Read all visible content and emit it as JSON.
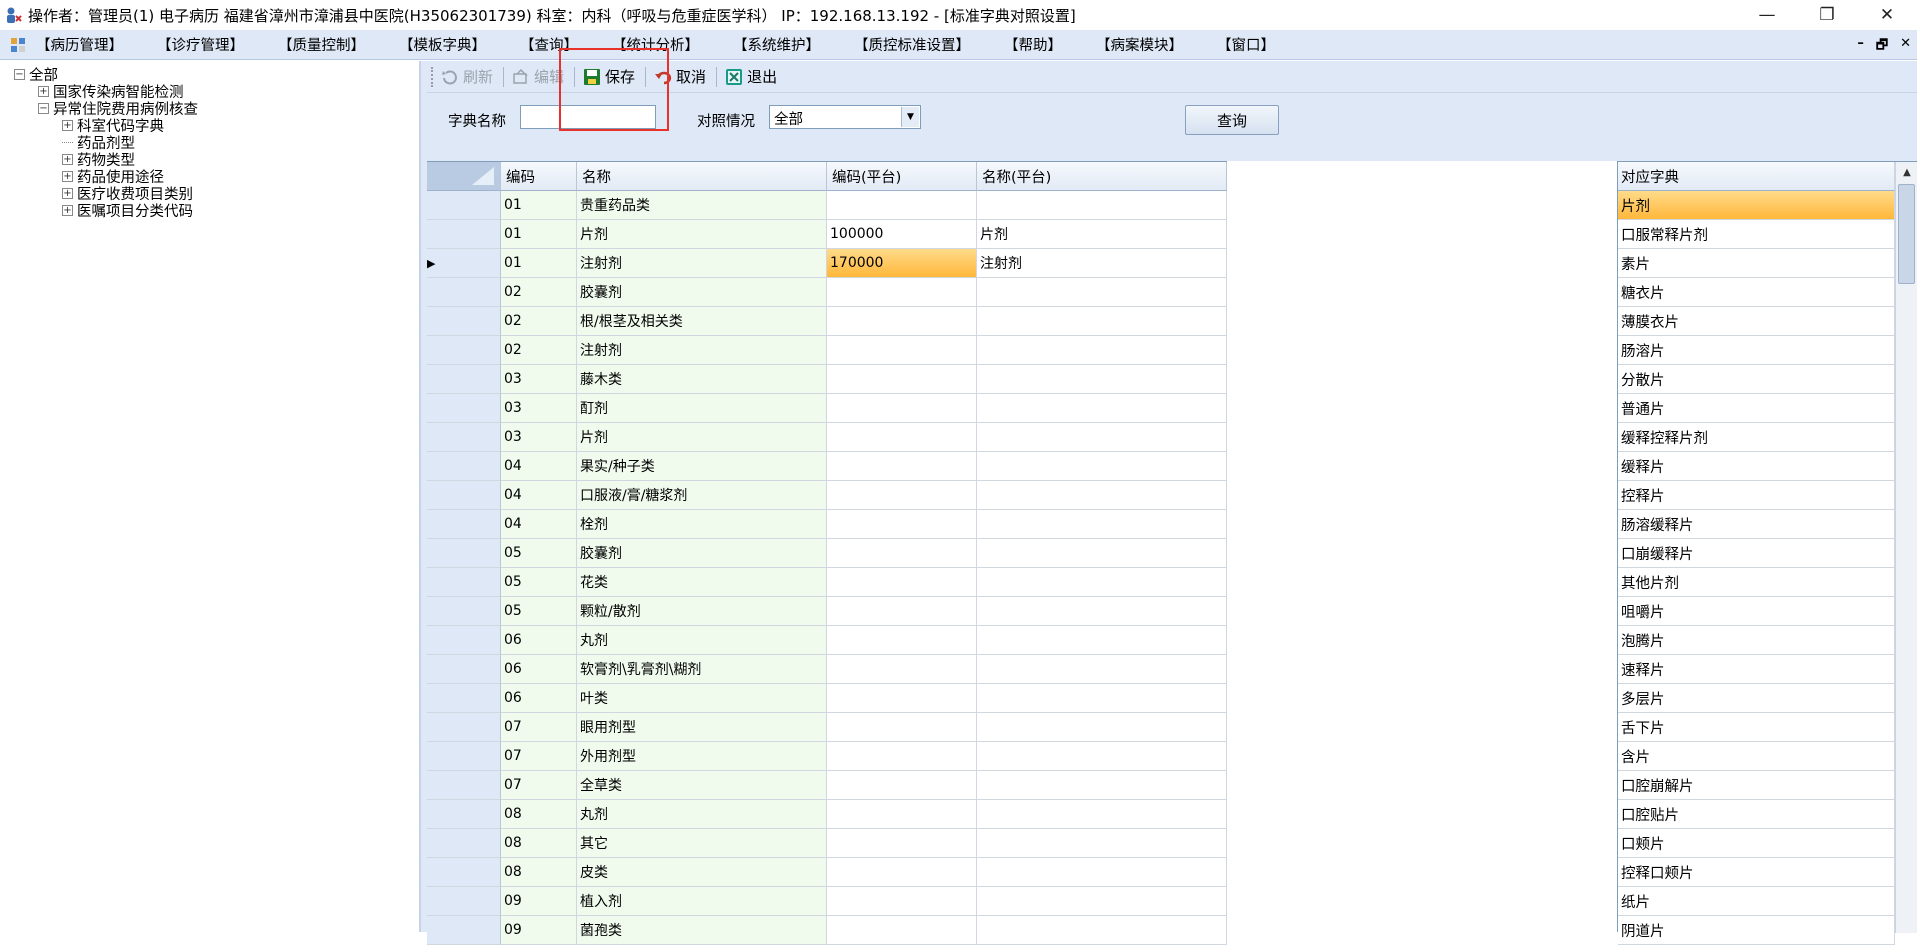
{
  "window": {
    "title": "操作者：管理员(1) 电子病历  福建省漳州市漳浦县中医院(H35062301739)  科室：内科（呼吸与危重症医学科）  IP：192.168.13.192 - [标准字典对照设置]",
    "minimize": "—",
    "maximize": "❐",
    "close": "✕"
  },
  "menu": [
    "【病历管理】",
    "【诊疗管理】",
    "【质量控制】",
    "【模板字典】",
    "【查询】",
    "【统计分析】",
    "【系统维护】",
    "【质控标准设置】",
    "【帮助】",
    "【病案模块】",
    "【窗口】"
  ],
  "mdi_controls": {
    "min": "–",
    "restore": "🗗",
    "close": "✕"
  },
  "tree": {
    "root": "全部",
    "nodes": [
      "国家传染病智能检测",
      "异常住院费用病例核查"
    ],
    "children": [
      "科室代码字典",
      "药品剂型",
      "药物类型",
      "药品使用途径",
      "医疗收费项目类别",
      "医嘱项目分类代码"
    ]
  },
  "toolbar": {
    "refresh": "刷新",
    "edit": "编辑",
    "save": "保存",
    "cancel": "取消",
    "exit": "退出"
  },
  "filter": {
    "dict_name_label": "字典名称",
    "dict_name_value": "",
    "match_label": "对照情况",
    "match_value": "全部",
    "query_button": "查询"
  },
  "grid": {
    "headers": [
      "编码",
      "名称",
      "编码(平台)",
      "名称(平台)"
    ],
    "rows": [
      [
        "01",
        "贵重药品类",
        "",
        ""
      ],
      [
        "01",
        "片剂",
        "100000",
        "片剂"
      ],
      [
        "01",
        "注射剂",
        "170000",
        "注射剂"
      ],
      [
        "02",
        "胶囊剂",
        "",
        ""
      ],
      [
        "02",
        "根/根茎及相关类",
        "",
        ""
      ],
      [
        "02",
        "注射剂",
        "",
        ""
      ],
      [
        "03",
        "藤木类",
        "",
        ""
      ],
      [
        "03",
        "酊剂",
        "",
        ""
      ],
      [
        "03",
        "片剂",
        "",
        ""
      ],
      [
        "04",
        "果实/种子类",
        "",
        ""
      ],
      [
        "04",
        "口服液/膏/糖浆剂",
        "",
        ""
      ],
      [
        "04",
        "栓剂",
        "",
        ""
      ],
      [
        "05",
        "胶囊剂",
        "",
        ""
      ],
      [
        "05",
        "花类",
        "",
        ""
      ],
      [
        "05",
        "颗粒/散剂",
        "",
        ""
      ],
      [
        "06",
        "丸剂",
        "",
        ""
      ],
      [
        "06",
        "软膏剂\\乳膏剂\\糊剂",
        "",
        ""
      ],
      [
        "06",
        "叶类",
        "",
        ""
      ],
      [
        "07",
        "眼用剂型",
        "",
        ""
      ],
      [
        "07",
        "外用剂型",
        "",
        ""
      ],
      [
        "07",
        "全草类",
        "",
        ""
      ],
      [
        "08",
        "丸剂",
        "",
        ""
      ],
      [
        "08",
        "其它",
        "",
        ""
      ],
      [
        "08",
        "皮类",
        "",
        ""
      ],
      [
        "09",
        "植入剂",
        "",
        ""
      ],
      [
        "09",
        "菌孢类",
        "",
        ""
      ]
    ],
    "current_row_marker": "▶"
  },
  "right_list": {
    "header": "对应字典",
    "items": [
      "片剂",
      "口服常释片剂",
      "素片",
      "糖衣片",
      "薄膜衣片",
      "肠溶片",
      "分散片",
      "普通片",
      "缓释控释片剂",
      "缓释片",
      "控释片",
      "肠溶缓释片",
      "口崩缓释片",
      "其他片剂",
      "咀嚼片",
      "泡腾片",
      "速释片",
      "多层片",
      "舌下片",
      "含片",
      "口腔崩解片",
      "口腔贴片",
      "口颊片",
      "控释口颊片",
      "纸片",
      "阴道片"
    ]
  }
}
